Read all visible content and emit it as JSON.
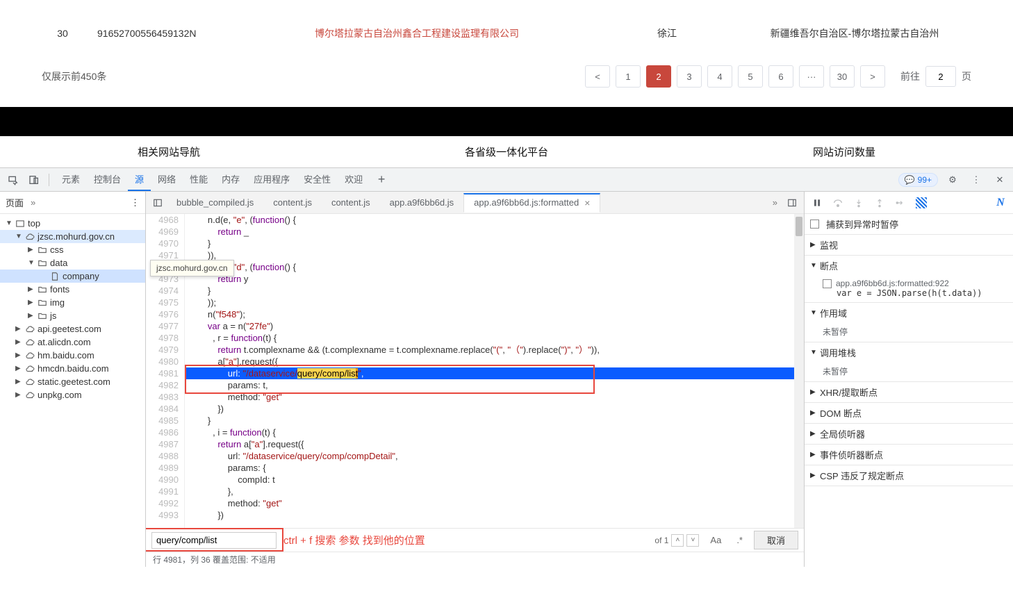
{
  "webpage": {
    "row": {
      "num": "30",
      "id": "91652700556459132N",
      "company": "博尔塔拉蒙古自治州鑫合工程建设监理有限公司",
      "person": "徐江",
      "region": "新疆维吾尔自治区-博尔塔拉蒙古自治州"
    },
    "displayNote": "仅展示前450条",
    "pages": [
      "1",
      "2",
      "3",
      "4",
      "5",
      "6",
      "···",
      "30"
    ],
    "activePage": "2",
    "gotoPrefix": "前往",
    "gotoValue": "2",
    "gotoSuffix": "页"
  },
  "footerNav": {
    "links": [
      "相关网站导航",
      "各省级一体化平台",
      "网站访问数量"
    ]
  },
  "devtoolsTabs": {
    "items": [
      "元素",
      "控制台",
      "源",
      "网络",
      "性能",
      "内存",
      "应用程序",
      "安全性",
      "欢迎"
    ],
    "active": "源",
    "msgCount": "99+"
  },
  "pageNavHeader": "页面",
  "tooltip": "jzsc.mohurd.gov.cn",
  "pageTree": [
    {
      "level": 0,
      "caret": "▼",
      "icon": "frame",
      "label": "top"
    },
    {
      "level": 1,
      "caret": "▼",
      "icon": "cloud",
      "label": "jzsc.mohurd.gov.cn",
      "sel": true
    },
    {
      "level": 2,
      "caret": "▶",
      "icon": "folder",
      "label": "css"
    },
    {
      "level": 2,
      "caret": "▼",
      "icon": "folder",
      "label": "data"
    },
    {
      "level": 3,
      "caret": "",
      "icon": "file",
      "label": "company",
      "hl": true
    },
    {
      "level": 2,
      "caret": "▶",
      "icon": "folder",
      "label": "fonts"
    },
    {
      "level": 2,
      "caret": "▶",
      "icon": "folder",
      "label": "img"
    },
    {
      "level": 2,
      "caret": "▶",
      "icon": "folder",
      "label": "js"
    },
    {
      "level": 1,
      "caret": "▶",
      "icon": "cloud",
      "label": "api.geetest.com"
    },
    {
      "level": 1,
      "caret": "▶",
      "icon": "cloud",
      "label": "at.alicdn.com"
    },
    {
      "level": 1,
      "caret": "▶",
      "icon": "cloud",
      "label": "hm.baidu.com"
    },
    {
      "level": 1,
      "caret": "▶",
      "icon": "cloud",
      "label": "hmcdn.baidu.com"
    },
    {
      "level": 1,
      "caret": "▶",
      "icon": "cloud",
      "label": "static.geetest.com"
    },
    {
      "level": 1,
      "caret": "▶",
      "icon": "cloud",
      "label": "unpkg.com"
    }
  ],
  "fileTabs": {
    "items": [
      "bubble_compiled.js",
      "content.js",
      "content.js",
      "app.a9f6bb6d.js",
      "app.a9f6bb6d.js:formatted"
    ],
    "active": "app.a9f6bb6d.js:formatted"
  },
  "code": {
    "startLine": 4968,
    "lines": [
      "        n.d(e, \"e\", (function() {",
      "            return _",
      "        }",
      "        )),",
      "        n.d(e, \"d\", (function() {",
      "            return y",
      "        }",
      "        ));",
      "        n(\"f548\");",
      "        var a = n(\"27fe\")",
      "          , r = function(t) {",
      "            return t.complexname && (t.complexname = t.complexname.replace(\"(\", \"（\").replace(\")\", \"）\")),",
      "            a[\"a\"].request({",
      "                url: \"/dataservice/query/comp/list\",",
      "                params: t,",
      "                method: \"get\"",
      "            })",
      "        }",
      "          , i = function(t) {",
      "            return a[\"a\"].request({",
      "                url: \"/dataservice/query/comp/compDetail\",",
      "                params: {",
      "                    compId: t",
      "                },",
      "                method: \"get\"",
      "            })"
    ]
  },
  "searchBar": {
    "value": "query/comp/list",
    "note": "ctrl + f 搜索 参数 找到他的位置",
    "resultCount": "of 1",
    "opt1": "Aa",
    "opt2": ".*",
    "cancel": "取消"
  },
  "statusLine": "行 4981，列 36    覆盖范围: 不适用",
  "debug": {
    "pauseOnException": "捕获到异常时暂停",
    "watch": "监视",
    "breakpoints": "断点",
    "breakpointItem": "app.a9f6bb6d.js:formatted:922",
    "breakpointCode": "var e = JSON.parse(h(t.data))",
    "scope": "作用域",
    "notPaused": "未暂停",
    "callStack": "调用堆栈",
    "xhrBp": "XHR/提取断点",
    "domBp": "DOM 断点",
    "globalListeners": "全局侦听器",
    "eventBp": "事件侦听器断点",
    "cspViolation": "CSP 违反了规定断点"
  }
}
